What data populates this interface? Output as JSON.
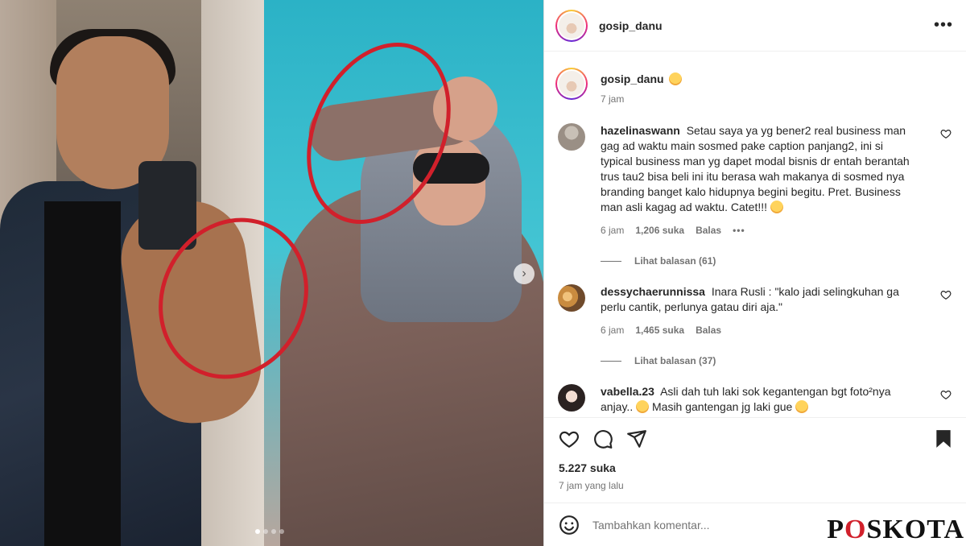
{
  "post": {
    "username": "gosip_danu",
    "more_icon": "more-horizontal-icon",
    "caption_emoji": "grinning-squinting-face-emoji",
    "caption_time": "7 jam",
    "carousel": {
      "slide_count": 4,
      "active_index": 0
    }
  },
  "comments": [
    {
      "username": "hazelinaswann",
      "text": "Setau saya ya yg bener2 real business man gag ad waktu main sosmed pake caption panjang2, ini si typical business man yg dapet modal bisnis dr entah berantah trus tau2 bisa beli ini itu berasa wah makanya di sosmed nya branding banget kalo hidupnya begini begitu. Pret. Business man asli kagag ad waktu. Catet!!!",
      "time": "6 jam",
      "likes": "1,206 suka",
      "reply": "Balas",
      "more": "•••",
      "view_replies": "Lihat balasan (61)"
    },
    {
      "username": "dessychaerunnissa",
      "text": "Inara Rusli : \"kalo jadi selingkuhan ga perlu cantik, perlunya gatau diri aja.\"",
      "time": "6 jam",
      "likes": "1,465 suka",
      "reply": "Balas",
      "view_replies": "Lihat balasan (37)"
    },
    {
      "username": "vabella.23",
      "text": "Asli dah tuh laki sok kegantengan bgt foto²nya anjay..",
      "text2": "Masih gantengan jg laki gue"
    }
  ],
  "actions": {
    "likes_count": "5.227 suka",
    "post_time": "7 jam yang lalu"
  },
  "add_comment": {
    "placeholder": "Tambahkan komentar..."
  },
  "watermark": {
    "before": "P",
    "o": "O",
    "after": "SKOTA"
  },
  "colors": {
    "accent_red": "#d1202b",
    "muted_text": "#737373",
    "border": "#dbdbdb"
  }
}
